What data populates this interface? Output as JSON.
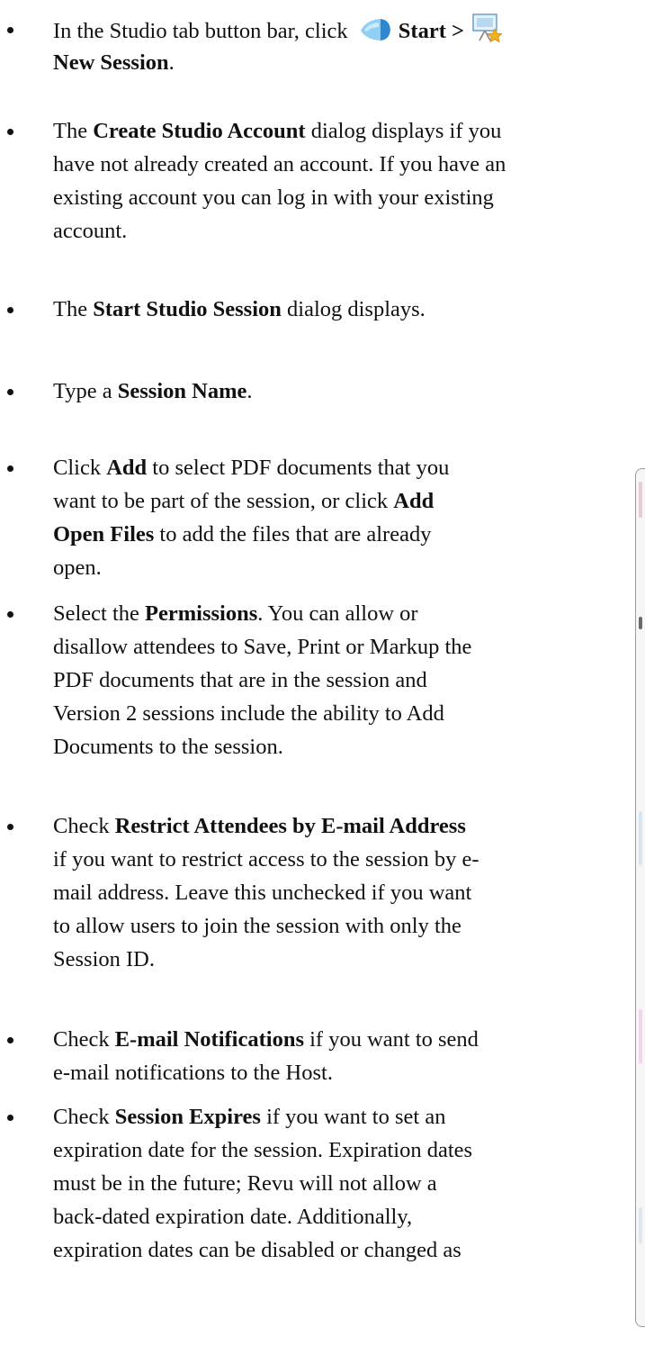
{
  "steps": [
    {
      "lines": [
        [
          {
            "t": "In the Studio tab button bar, click "
          },
          {
            "icon": "studio-start-icon"
          },
          {
            "b": "Start >"
          },
          {
            "icon": "new-session-icon"
          }
        ],
        [
          {
            "b": "New Session"
          },
          {
            "t": "."
          }
        ]
      ]
    },
    {
      "lines": [
        [
          {
            "t": "The "
          },
          {
            "b": "Create Studio Account"
          },
          {
            "t": " dialog displays if you"
          }
        ],
        [
          {
            "t": "have not already created an account. If you have an"
          }
        ],
        [
          {
            "t": "existing account you can log in with your existing"
          }
        ],
        [
          {
            "t": "account."
          }
        ]
      ]
    },
    {
      "lines": [
        [
          {
            "t": "The "
          },
          {
            "b": "Start Studio Session"
          },
          {
            "t": " dialog displays."
          }
        ]
      ]
    },
    {
      "lines": [
        [
          {
            "t": "Type a "
          },
          {
            "b": "Session Name"
          },
          {
            "t": "."
          }
        ]
      ]
    },
    {
      "lines": [
        [
          {
            "t": "Click "
          },
          {
            "b": "Add"
          },
          {
            "t": " to select PDF documents that you"
          }
        ],
        [
          {
            "t": "want to be part of the session, or click "
          },
          {
            "b": "Add"
          }
        ],
        [
          {
            "b": "Open Files"
          },
          {
            "t": " to add the files that are already"
          }
        ],
        [
          {
            "t": "open."
          }
        ]
      ]
    },
    {
      "lines": [
        [
          {
            "t": "Select the "
          },
          {
            "b": "Permissions"
          },
          {
            "t": ". You can allow or"
          }
        ],
        [
          {
            "t": "disallow attendees to Save, Print or Markup the"
          }
        ],
        [
          {
            "t": "PDF documents that are in the session and"
          }
        ],
        [
          {
            "t": "Version 2 sessions include the ability to Add"
          }
        ],
        [
          {
            "t": "Documents to the session."
          }
        ]
      ]
    },
    {
      "lines": [
        [
          {
            "t": "Check "
          },
          {
            "b": "Restrict Attendees by E-mail Address"
          }
        ],
        [
          {
            "t": "if you want to restrict access to the session by e-"
          }
        ],
        [
          {
            "t": "mail address. Leave this unchecked if you want"
          }
        ],
        [
          {
            "t": "to allow users to join the session with only the"
          }
        ],
        [
          {
            "t": "Session ID."
          }
        ]
      ]
    },
    {
      "lines": [
        [
          {
            "t": "Check "
          },
          {
            "b": "E-mail Notifications"
          },
          {
            "t": " if you want to send"
          }
        ],
        [
          {
            "t": "e-mail notifications to the Host."
          }
        ]
      ]
    },
    {
      "lines": [
        [
          {
            "t": "Check "
          },
          {
            "b": "Session Expires"
          },
          {
            "t": " if you want to set an"
          }
        ],
        [
          {
            "t": "expiration date for the session. Expiration dates"
          }
        ],
        [
          {
            "t": "must be in the future; Revu will not allow a"
          }
        ],
        [
          {
            "t": "back-dated expiration date. Additionally,"
          }
        ],
        [
          {
            "t": "expiration dates can be disabled or changed as"
          }
        ]
      ]
    }
  ]
}
